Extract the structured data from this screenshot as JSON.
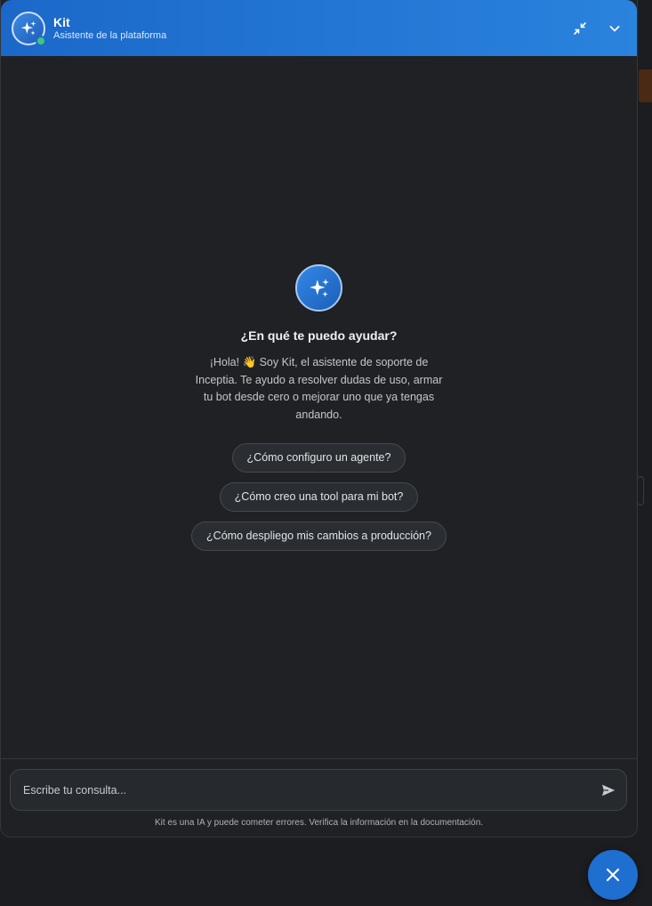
{
  "header": {
    "title": "Kit",
    "subtitle": "Asistente de la plataforma",
    "minimize_icon": "collapse-arrows-icon",
    "chevron_icon": "chevron-down-icon"
  },
  "welcome": {
    "heading": "¿En qué te puedo ayudar?",
    "intro": "¡Hola! 👋 Soy Kit, el asistente de soporte de Inceptia. Te ayudo a resolver dudas de uso, armar tu bot desde cero o mejorar uno que ya tengas andando."
  },
  "suggestions": [
    "¿Cómo configuro un agente?",
    "¿Cómo creo una tool para mi bot?",
    "¿Cómo despliego mis cambios a producción?"
  ],
  "composer": {
    "placeholder": "Escribe tu consulta...",
    "send_icon": "send-icon"
  },
  "disclaimer": "Kit es una IA y puede cometer errores. Verifica la información en la documentación.",
  "colors": {
    "header_start": "#1b68c9",
    "header_end": "#2a83dd",
    "panel_bg": "#1f2125",
    "status_online": "#3ec77a",
    "fab": "#1e6fd0"
  }
}
